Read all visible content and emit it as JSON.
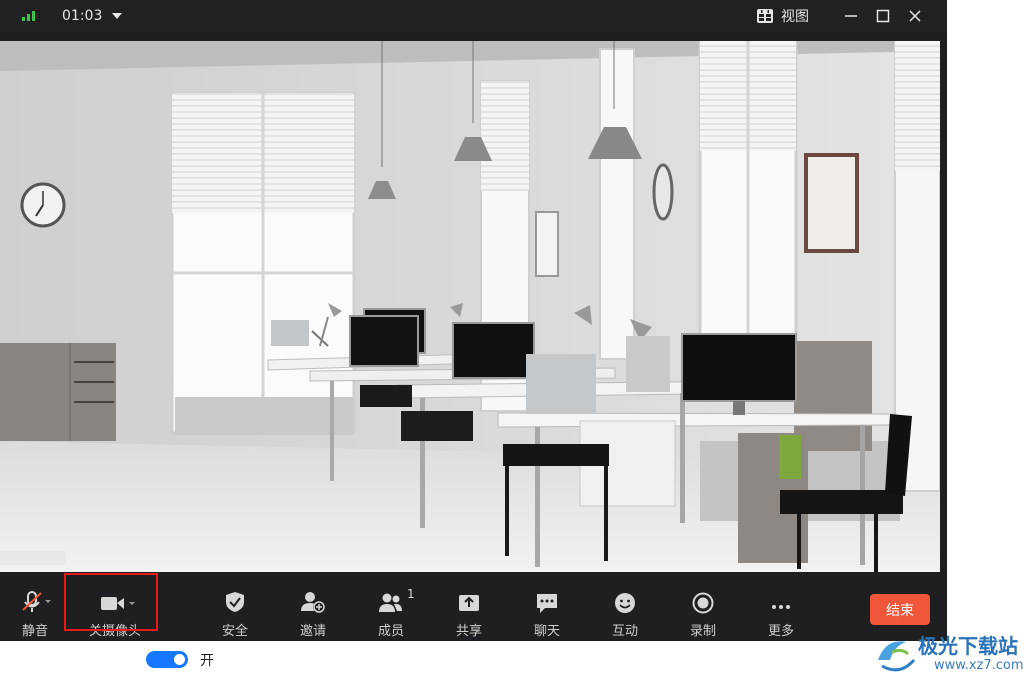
{
  "titlebar": {
    "time": "01:03",
    "view_label": "视图",
    "icons": [
      "signal-icon",
      "dropdown-icon",
      "view-grid-icon",
      "minimize-icon",
      "maximize-icon",
      "close-icon"
    ]
  },
  "toolbar": {
    "items": [
      {
        "id": "mute",
        "label": "静音",
        "icon": "mic-muted-icon"
      },
      {
        "id": "camera",
        "label": "关摄像头",
        "icon": "camera-icon"
      },
      {
        "id": "security",
        "label": "安全",
        "icon": "shield-icon"
      },
      {
        "id": "invite",
        "label": "邀请",
        "icon": "add-user-icon"
      },
      {
        "id": "members",
        "label": "成员",
        "icon": "members-icon",
        "count": "1"
      },
      {
        "id": "share",
        "label": "共享",
        "icon": "share-icon"
      },
      {
        "id": "chat",
        "label": "聊天",
        "icon": "chat-icon"
      },
      {
        "id": "interact",
        "label": "互动",
        "icon": "emoji-icon"
      },
      {
        "id": "record",
        "label": "录制",
        "icon": "record-icon"
      },
      {
        "id": "more",
        "label": "更多",
        "icon": "more-icon"
      }
    ],
    "end_label": "结束"
  },
  "toggle": {
    "state": "on",
    "label": "开"
  },
  "watermark": {
    "brand": "极光下载站",
    "url": "www.xz7.com"
  },
  "colors": {
    "accent": "#1677ff",
    "end": "#f0563a",
    "highlight": "#e81b1b",
    "signal": "#3cc24a"
  }
}
